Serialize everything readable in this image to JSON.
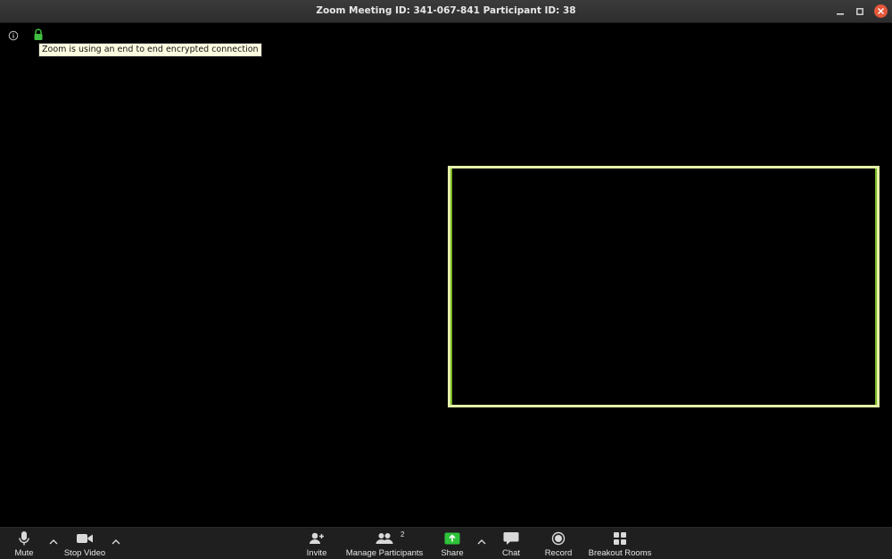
{
  "window": {
    "title": "Zoom Meeting ID: 341-067-841 Participant ID: 38"
  },
  "meeting": {
    "encryption_tooltip": "Zoom is using an end to end encrypted connection"
  },
  "toolbar": {
    "mute_label": "Mute",
    "stop_video_label": "Stop Video",
    "invite_label": "Invite",
    "manage_participants_label": "Manage Participants",
    "participants_count": "2",
    "share_label": "Share",
    "chat_label": "Chat",
    "record_label": "Record",
    "breakout_rooms_label": "Breakout Rooms"
  },
  "colors": {
    "share_accent": "#2dc33a",
    "close_button": "#e4573a",
    "active_speaker_border": "#e3f0a8",
    "tooltip_background": "#fffde0"
  }
}
